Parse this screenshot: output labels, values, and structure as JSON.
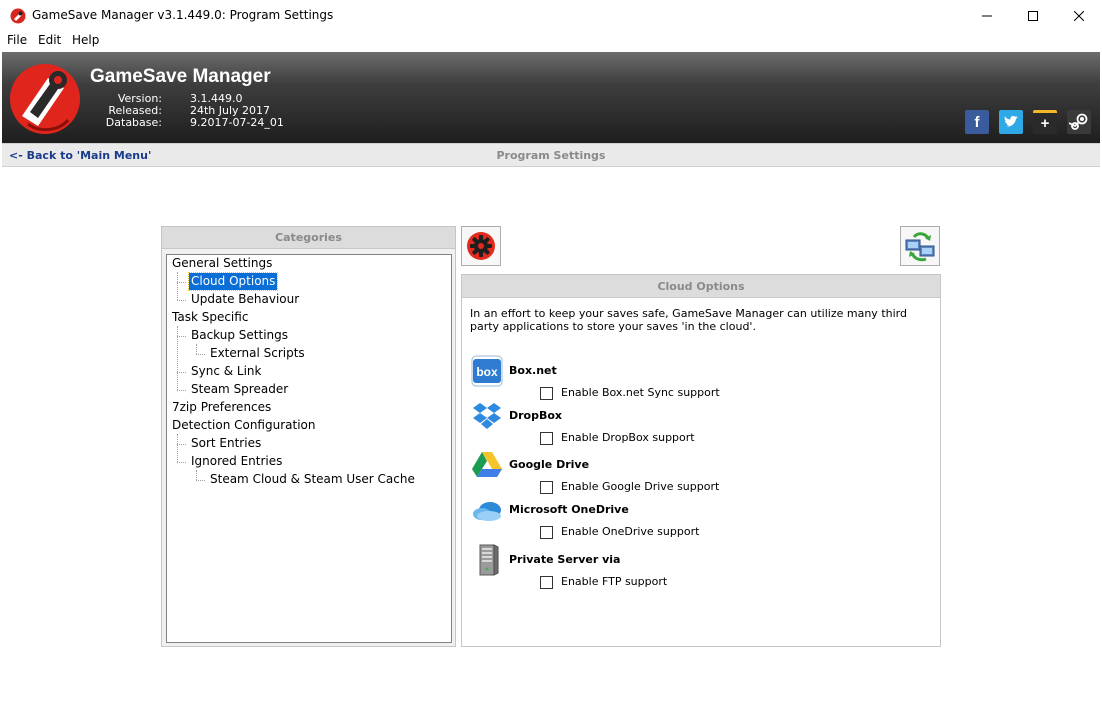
{
  "window": {
    "title": "GameSave Manager v3.1.449.0: Program Settings"
  },
  "menu": {
    "items": [
      "File",
      "Edit",
      "Help"
    ]
  },
  "banner": {
    "title": "GameSave Manager",
    "version_label": "Version:",
    "version_value": "3.1.449.0",
    "released_label": "Released:",
    "released_value": "24th July 2017",
    "database_label": "Database:",
    "database_value": "9.2017-07-24_01",
    "social": [
      "facebook-icon",
      "twitter-icon",
      "google-plus-icon",
      "steam-icon"
    ],
    "social_glyphs": {
      "facebook": "f",
      "google_plus": "+"
    }
  },
  "nav": {
    "back_label": "<- Back to 'Main Menu'",
    "page_title": "Program Settings"
  },
  "categories": {
    "header": "Categories",
    "items": [
      {
        "label": "General Settings",
        "level": 0
      },
      {
        "label": "Cloud Options",
        "level": 1,
        "selected": true
      },
      {
        "label": "Update Behaviour",
        "level": 1
      },
      {
        "label": "Task Specific",
        "level": 0
      },
      {
        "label": "Backup Settings",
        "level": 1
      },
      {
        "label": "External Scripts",
        "level": 2
      },
      {
        "label": "Sync & Link",
        "level": 1
      },
      {
        "label": "Steam Spreader",
        "level": 1
      },
      {
        "label": "7zip Preferences",
        "level": 0
      },
      {
        "label": "Detection Configuration",
        "level": 0
      },
      {
        "label": "Sort Entries",
        "level": 1
      },
      {
        "label": "Ignored Entries",
        "level": 1
      },
      {
        "label": "Steam Cloud & Steam User Cache",
        "level": 2
      }
    ]
  },
  "cloud": {
    "header": "Cloud Options",
    "description": "In an effort to keep your saves safe, GameSave Manager can utilize many third party applications to store your saves 'in the cloud'.",
    "services": [
      {
        "name": "Box.net",
        "checkbox": "Enable Box.net Sync support",
        "icon": "box-icon",
        "icon_text": "box",
        "checked": false
      },
      {
        "name": "DropBox",
        "checkbox": "Enable DropBox support",
        "icon": "dropbox-icon",
        "checked": false
      },
      {
        "name": "Google Drive",
        "checkbox": "Enable Google Drive support",
        "icon": "google-drive-icon",
        "checked": false
      },
      {
        "name": "Microsoft OneDrive",
        "checkbox": "Enable OneDrive support",
        "icon": "onedrive-icon",
        "checked": false
      },
      {
        "name": "Private Server via",
        "checkbox": "Enable FTP support",
        "icon": "server-icon",
        "checked": false
      }
    ]
  },
  "colors": {
    "selection": "#0a6ed6",
    "back_link": "#1a3c8a",
    "facebook": "#3b5c9c",
    "twitter": "#2fa8e6"
  }
}
